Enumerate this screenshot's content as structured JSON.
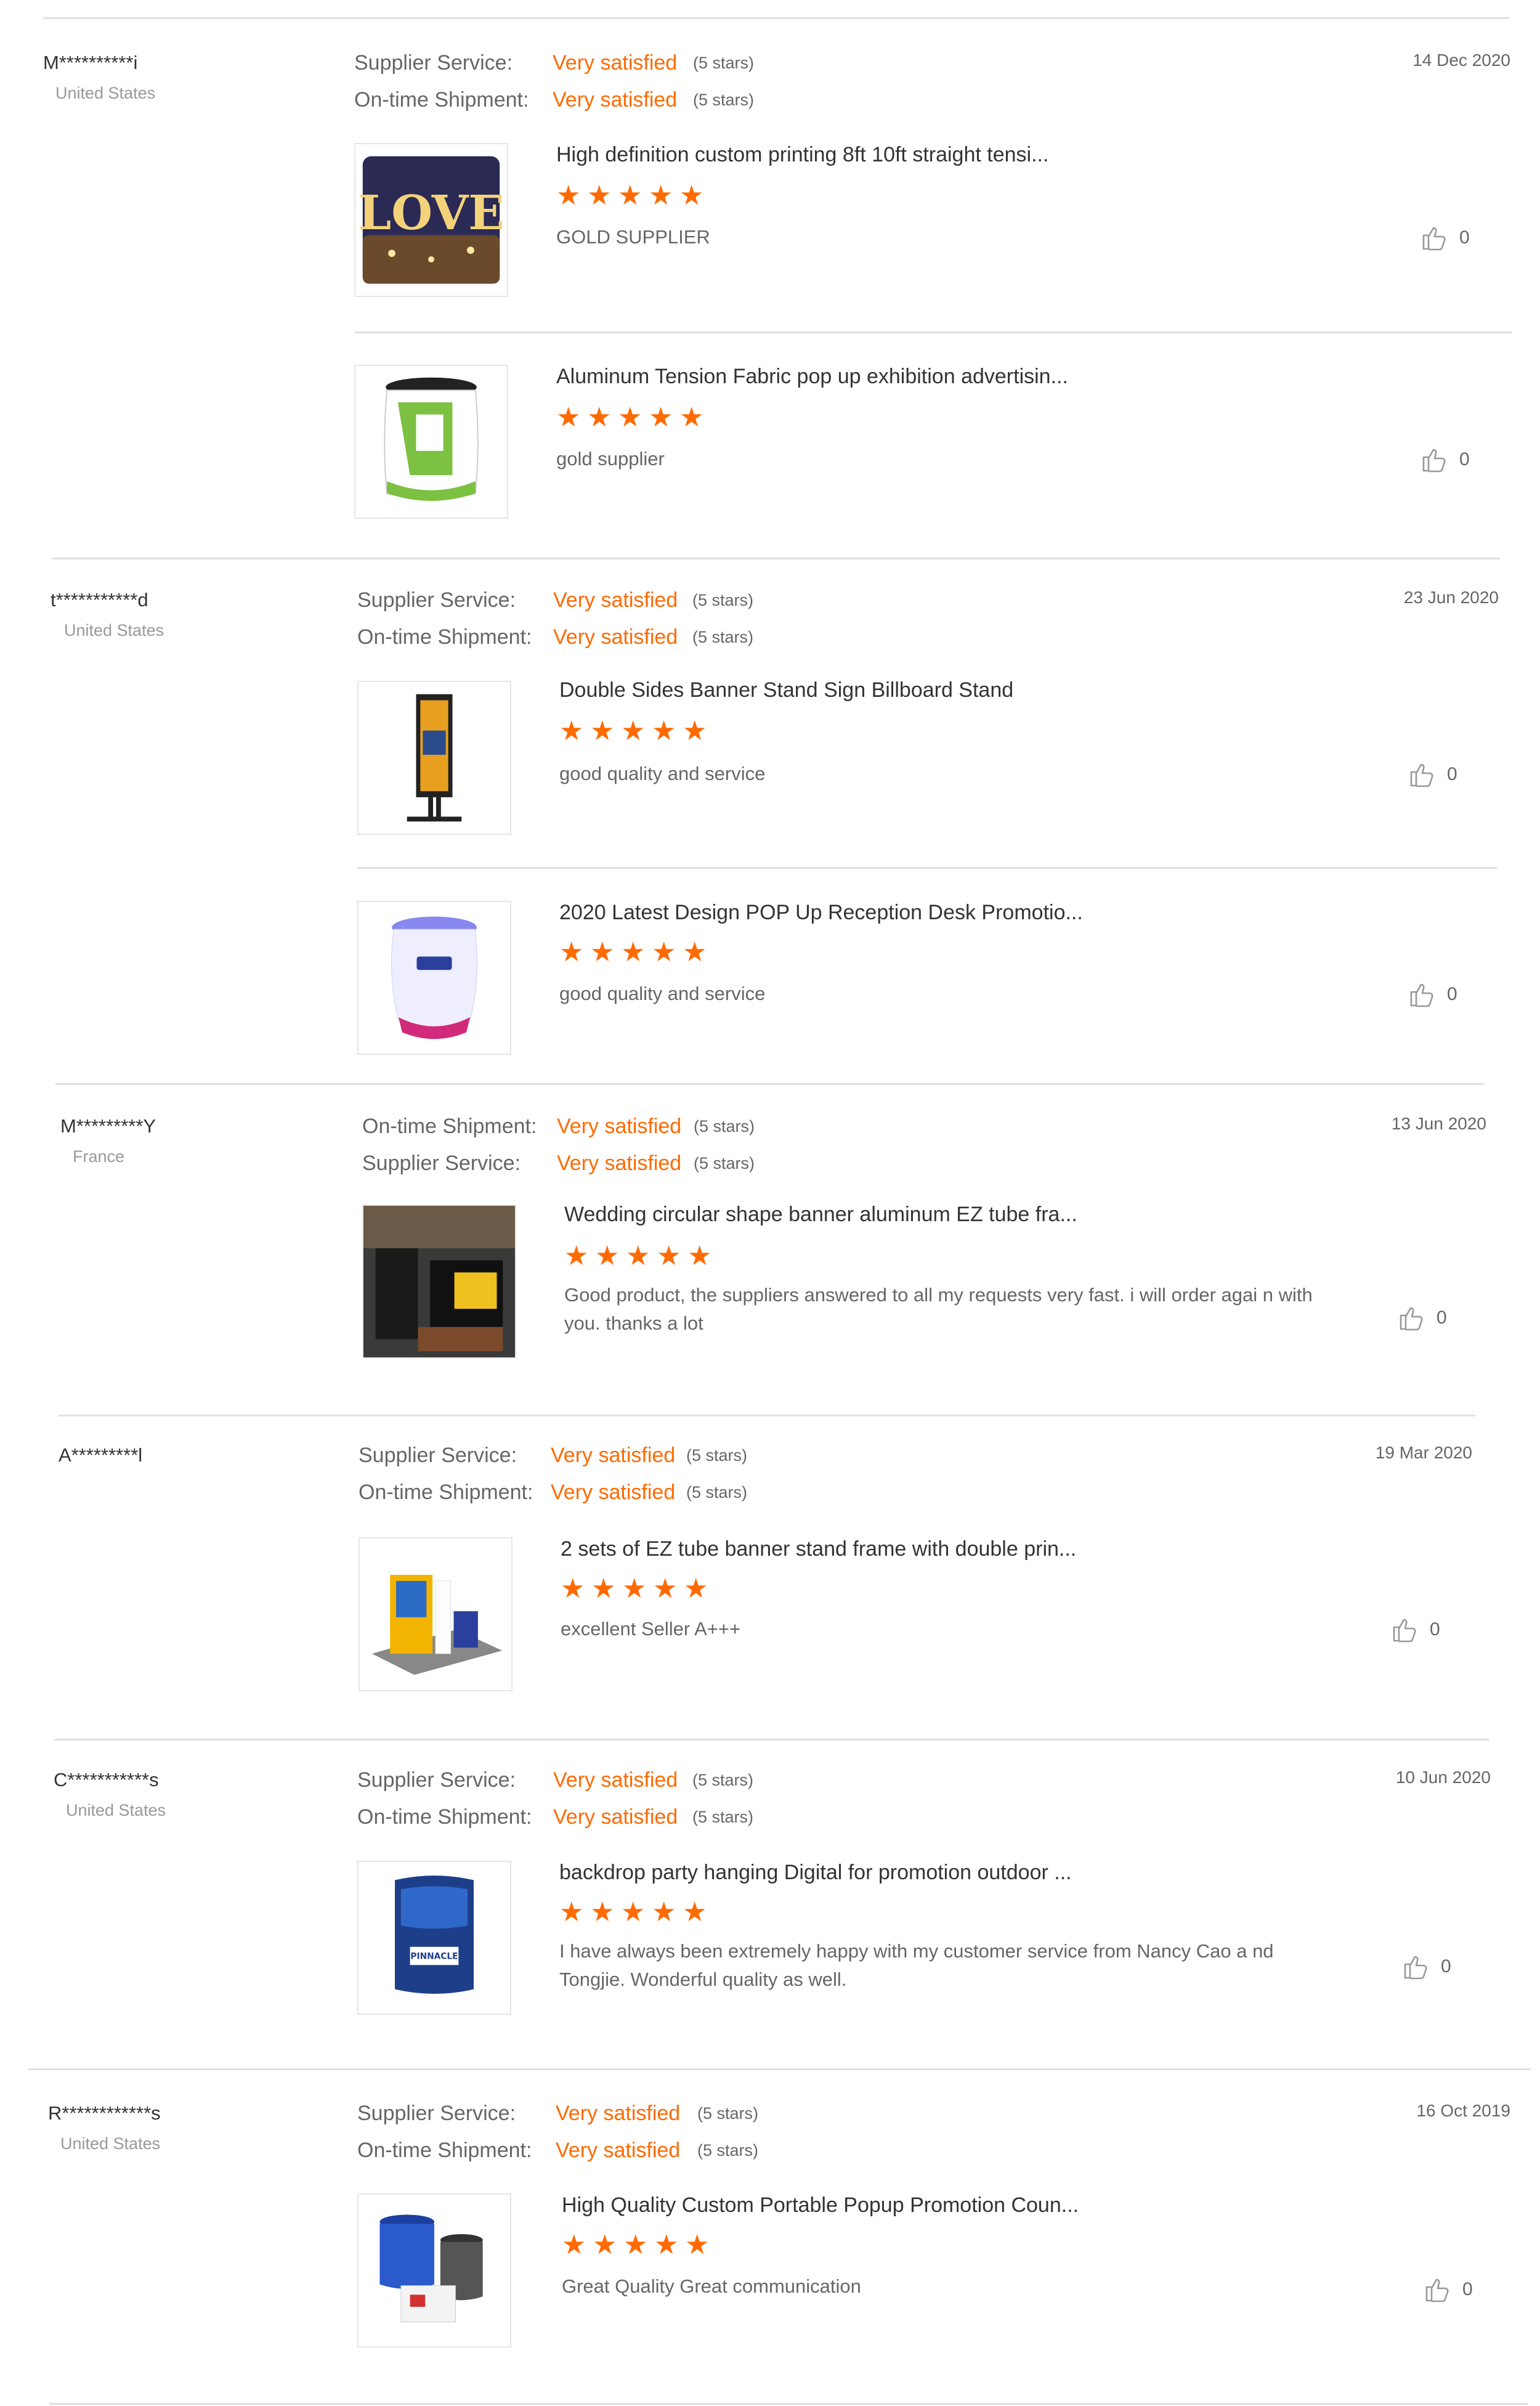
{
  "reviews": [
    {
      "user": "M**********i",
      "country": "United States",
      "date": "14 Dec 2020",
      "ratings": [
        {
          "label": "Supplier Service:",
          "value": "Very satisfied",
          "stars": "(5 stars)"
        },
        {
          "label": "On-time Shipment:",
          "value": "Very satisfied",
          "stars": "(5 stars)"
        }
      ],
      "products": [
        {
          "title": "High definition custom printing 8ft 10ft straight tensi...",
          "feedback": "GOLD SUPPLIER",
          "likes": "0",
          "thumb_icon": "love-backdrop-image"
        },
        {
          "title": "Aluminum Tension Fabric pop up exhibition advertisin...",
          "feedback": "gold supplier",
          "likes": "0",
          "thumb_icon": "counter-image"
        }
      ]
    },
    {
      "user": "t***********d",
      "country": "United States",
      "date": "23 Jun 2020",
      "ratings": [
        {
          "label": "Supplier Service:",
          "value": "Very satisfied",
          "stars": "(5 stars)"
        },
        {
          "label": "On-time Shipment:",
          "value": "Very satisfied",
          "stars": "(5 stars)"
        }
      ],
      "products": [
        {
          "title": "Double Sides Banner Stand Sign Billboard Stand",
          "feedback": "good quality and service",
          "likes": "0",
          "thumb_icon": "billboard-stand-image"
        },
        {
          "title": "2020 Latest Design POP Up Reception Desk Promotio...",
          "feedback": "good quality and service",
          "likes": "0",
          "thumb_icon": "reception-desk-image"
        }
      ]
    },
    {
      "user": "M*********Y",
      "country": "France",
      "date": "13 Jun 2020",
      "ratings": [
        {
          "label": "On-time Shipment:",
          "value": "Very satisfied",
          "stars": "(5 stars)"
        },
        {
          "label": "Supplier Service:",
          "value": "Very satisfied",
          "stars": "(5 stars)"
        }
      ],
      "products": [
        {
          "title": "Wedding circular shape banner aluminum EZ tube fra...",
          "feedback": "Good product, the suppliers answered to all my requests very fast. i will order agai n with you. thanks a lot",
          "likes": "0",
          "thumb_icon": "banner-photo-image"
        }
      ]
    },
    {
      "user": "A*********l",
      "country": "",
      "date": "19 Mar 2020",
      "ratings": [
        {
          "label": "Supplier Service:",
          "value": "Very satisfied",
          "stars": "(5 stars)"
        },
        {
          "label": "On-time Shipment:",
          "value": "Very satisfied",
          "stars": "(5 stars)"
        }
      ],
      "products": [
        {
          "title": "2 sets of EZ tube banner stand frame with double prin...",
          "feedback": "excellent Seller A+++",
          "likes": "0",
          "thumb_icon": "booth-image"
        }
      ]
    },
    {
      "user": "C***********s",
      "country": "United States",
      "date": "10 Jun 2020",
      "ratings": [
        {
          "label": "Supplier Service:",
          "value": "Very satisfied",
          "stars": "(5 stars)"
        },
        {
          "label": "On-time Shipment:",
          "value": "Very satisfied",
          "stars": "(5 stars)"
        }
      ],
      "products": [
        {
          "title": "backdrop party hanging Digital for promotion outdoor ...",
          "feedback": "I have always been extremely happy with my customer service from Nancy Cao a nd Tongjie.  Wonderful quality as well.",
          "likes": "0",
          "thumb_icon": "hanging-banner-image"
        }
      ]
    },
    {
      "user": "R************s",
      "country": "United States",
      "date": "16 Oct 2019",
      "ratings": [
        {
          "label": "Supplier Service:",
          "value": "Very satisfied",
          "stars": "(5 stars)"
        },
        {
          "label": "On-time Shipment:",
          "value": "Very satisfied",
          "stars": "(5 stars)"
        }
      ],
      "products": [
        {
          "title": "High Quality Custom Portable Popup Promotion Coun...",
          "feedback": "Great Quality Great communication",
          "likes": "0",
          "thumb_icon": "popup-counters-image"
        }
      ]
    }
  ],
  "colors": {
    "accent": "#ff6a00",
    "text": "#666666",
    "title": "#333333",
    "divider": "#e0e0e0"
  },
  "star_rating": 5
}
